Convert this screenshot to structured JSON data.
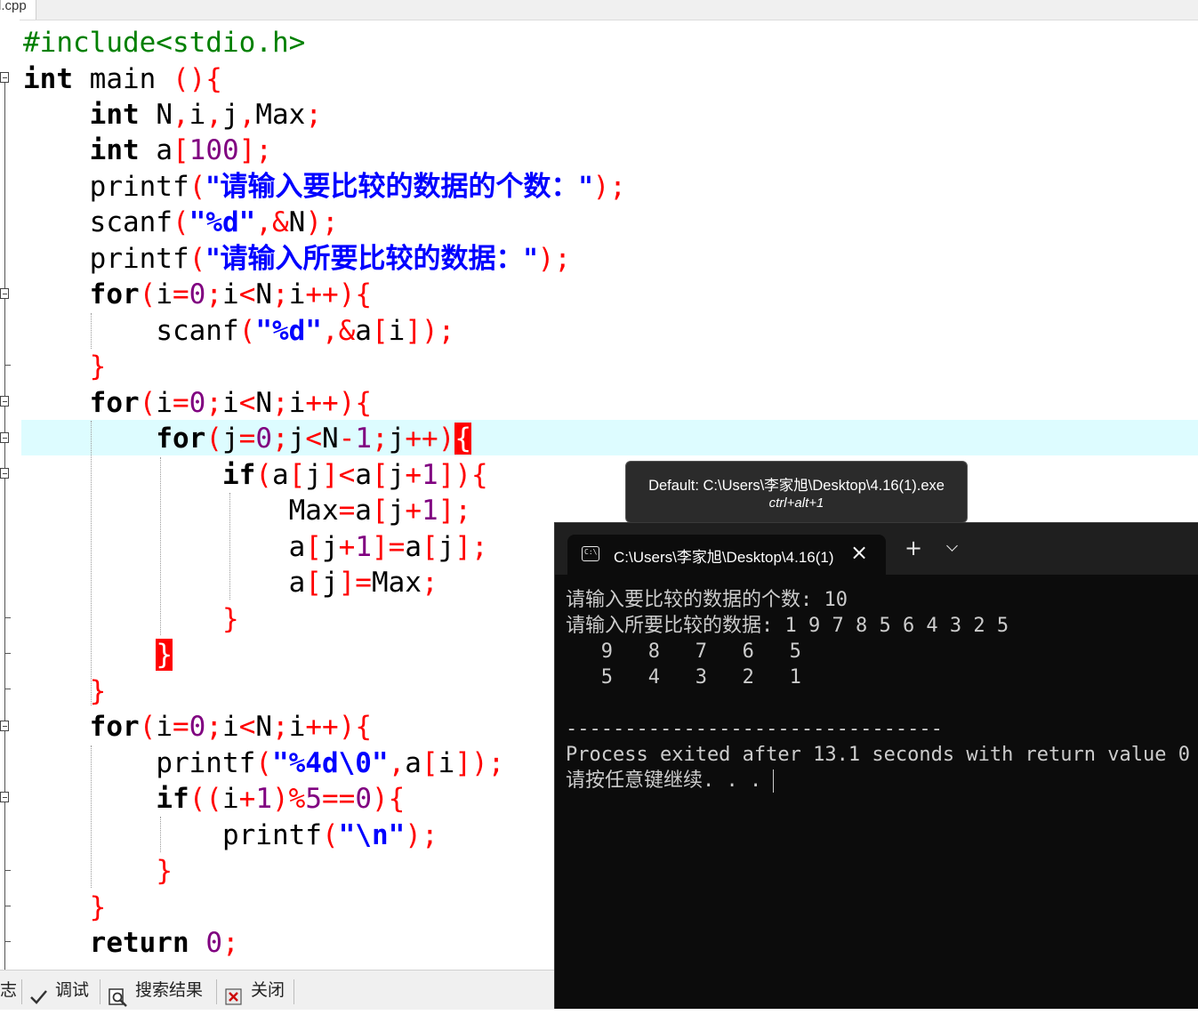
{
  "editor": {
    "tab_label": "l.cpp",
    "lines": {
      "l0": {
        "a": "#include<stdio.h>"
      },
      "l1": {
        "a": "int",
        "b": " main ",
        "c": "(){"
      },
      "l2": {
        "a": "int",
        "b": " N",
        "c": ",",
        "d": "i",
        "e": ",",
        "f": "j",
        "g": ",",
        "h": "Max",
        "i": ";"
      },
      "l3": {
        "a": "int",
        "b": " a",
        "c": "[",
        "d": "100",
        "e": "];"
      },
      "l4": {
        "a": "printf",
        "b": "(",
        "c": "\"请输入要比较的数据的个数：\"",
        "d": ");"
      },
      "l5": {
        "a": "scanf",
        "b": "(",
        "c": "\"%d\"",
        "d": ",&",
        "e": "N",
        "f": ");"
      },
      "l6": {
        "a": "printf",
        "b": "(",
        "c": "\"请输入所要比较的数据：\"",
        "d": ");"
      },
      "l7": {
        "a": "for",
        "b": "(",
        "c": "i",
        "d": "=",
        "e": "0",
        "f": ";",
        "g": "i",
        "h": "<",
        "i": "N",
        "j": ";",
        "k": "i",
        "l": "++){"
      },
      "l8": {
        "a": "scanf",
        "b": "(",
        "c": "\"%d\"",
        "d": ",&",
        "e": "a",
        "f": "[",
        "g": "i",
        "h": "]);"
      },
      "l9": {
        "a": "}"
      },
      "l10": {
        "a": "for",
        "b": "(",
        "c": "i",
        "d": "=",
        "e": "0",
        "f": ";",
        "g": "i",
        "h": "<",
        "i": "N",
        "j": ";",
        "k": "i",
        "l": "++){"
      },
      "l11": {
        "a": "for",
        "b": "(",
        "c": "j",
        "d": "=",
        "e": "0",
        "f": ";",
        "g": "j",
        "h": "<",
        "i": "N",
        "j": "-",
        "k": "1",
        "l": ";",
        "m": "j",
        "n": "++)",
        "o": "{"
      },
      "l12": {
        "a": "if",
        "b": "(",
        "c": "a",
        "d": "[",
        "e": "j",
        "f": "]<",
        "g": "a",
        "h": "[",
        "i": "j",
        "j": "+",
        "k": "1",
        "l": "]){"
      },
      "l13": {
        "a": "Max",
        "b": "=",
        "c": "a",
        "d": "[",
        "e": "j",
        "f": "+",
        "g": "1",
        "h": "];"
      },
      "l14": {
        "a": "a",
        "b": "[",
        "c": "j",
        "d": "+",
        "e": "1",
        "f": "]=",
        "g": "a",
        "h": "[",
        "i": "j",
        "j": "];"
      },
      "l15": {
        "a": "a",
        "b": "[",
        "c": "j",
        "d": "]=",
        "e": "Max",
        "f": ";"
      },
      "l16": {
        "a": "}"
      },
      "l17": {
        "a": "}"
      },
      "l18": {
        "a": "}"
      },
      "l19": {
        "a": "for",
        "b": "(",
        "c": "i",
        "d": "=",
        "e": "0",
        "f": ";",
        "g": "i",
        "h": "<",
        "i": "N",
        "j": ";",
        "k": "i",
        "l": "++){"
      },
      "l20": {
        "a": "printf",
        "b": "(",
        "c": "\"%4d\\0\"",
        "d": ",",
        "e": "a",
        "f": "[",
        "g": "i",
        "h": "]);"
      },
      "l21": {
        "a": "if",
        "b": "((",
        "c": "i",
        "d": "+",
        "e": "1",
        "f": ")%",
        "g": "5",
        "h": "==",
        "i": "0",
        "j": "){"
      },
      "l22": {
        "a": "printf",
        "b": "(",
        "c": "\"\\n\"",
        "d": ");"
      },
      "l23": {
        "a": "}"
      },
      "l24": {
        "a": "}"
      },
      "l25": {
        "a": "return",
        "b": " ",
        "c": "0",
        "d": ";"
      }
    }
  },
  "bottom_tabs": {
    "partial": "志",
    "debug": "调试",
    "search_results": "搜索结果",
    "close": "关闭"
  },
  "tooltip": {
    "title": "Default: C:\\Users\\李家旭\\Desktop\\4.16(1).exe",
    "shortcut": "ctrl+alt+1"
  },
  "terminal": {
    "tab_title": "C:\\Users\\李家旭\\Desktop\\4.16(1).exe",
    "lines": [
      "请输入要比较的数据的个数: 10",
      "请输入所要比较的数据: 1 9 7 8 5 6 4 3 2 5",
      "   9   8   7   6   5",
      "   5   4   3   2   1",
      "",
      "--------------------------------",
      "Process exited after 13.1 seconds with return value 0",
      "请按任意键继续. . . "
    ]
  },
  "colors": {
    "keyword": "#000000",
    "preprocessor": "#008000",
    "symbol": "#ff0000",
    "number": "#800080",
    "string": "#0000ff",
    "current_line": "#ddfcff",
    "terminal_bg": "#0c0c0c"
  }
}
